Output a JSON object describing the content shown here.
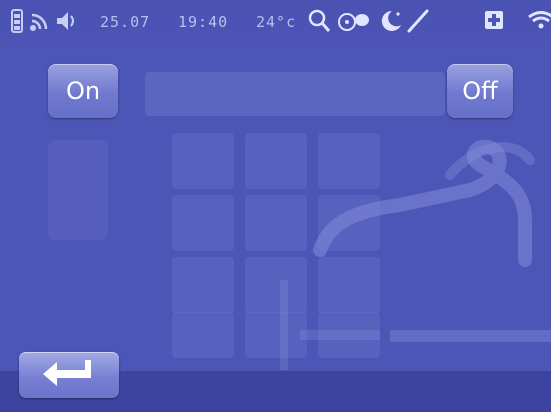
{
  "status_bar": {
    "date": "25.07",
    "time": "19:40",
    "temperature": "24°c",
    "icons": [
      "battery-icon",
      "signal-icon",
      "speaker-icon",
      "search-icon",
      "chat-icon",
      "moon-icon",
      "pen-icon",
      "plus-icon",
      "wifi-icon"
    ]
  },
  "controls": {
    "on_label": "On",
    "off_label": "Off"
  },
  "navigation": {
    "back_icon": "return-arrow-icon"
  },
  "colors": {
    "background": "#4c56b6",
    "button": "#7a82d2",
    "text": "#ffffff"
  }
}
